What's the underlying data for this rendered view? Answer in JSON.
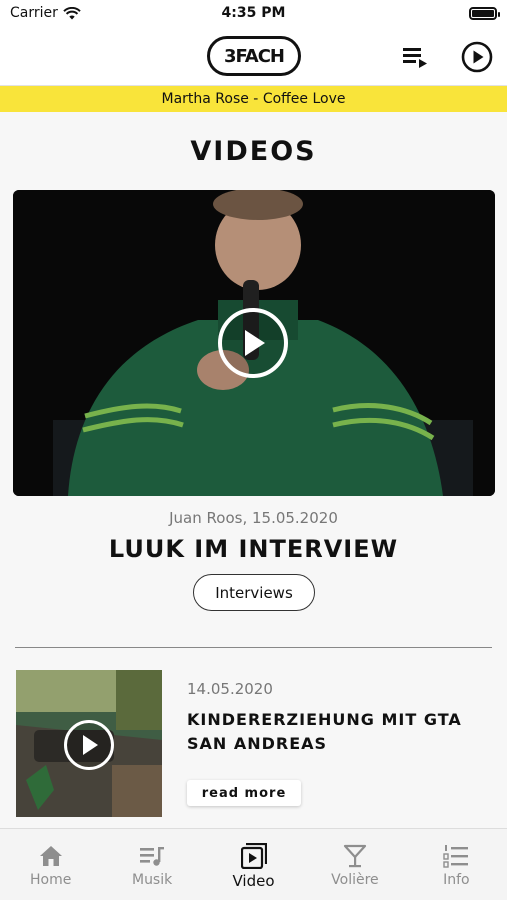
{
  "status_bar": {
    "carrier": "Carrier",
    "time": "4:35 PM"
  },
  "header": {
    "logo_text": "3FACH",
    "playlist_icon": "playlist-icon",
    "play_icon": "play-circle-icon"
  },
  "now_playing": {
    "text": "Martha Rose - Coffee Love",
    "background": "#f9e43a"
  },
  "main": {
    "section_title": "VIDEOS",
    "featured": {
      "meta": "Juan Roos, 15.05.2020",
      "title": "LUUK IM INTERVIEW",
      "tag": "Interviews"
    },
    "items": [
      {
        "date": "14.05.2020",
        "title": "KINDERERZIEHUNG MIT GTA SAN ANDREAS",
        "read_more": "read more"
      }
    ]
  },
  "tabbar": {
    "tabs": [
      {
        "label": "Home",
        "icon": "home-icon",
        "active": false
      },
      {
        "label": "Musik",
        "icon": "music-list-icon",
        "active": false
      },
      {
        "label": "Video",
        "icon": "video-icon",
        "active": true
      },
      {
        "label": "Volière",
        "icon": "cocktail-icon",
        "active": false
      },
      {
        "label": "Info",
        "icon": "numbered-list-icon",
        "active": false
      }
    ]
  }
}
